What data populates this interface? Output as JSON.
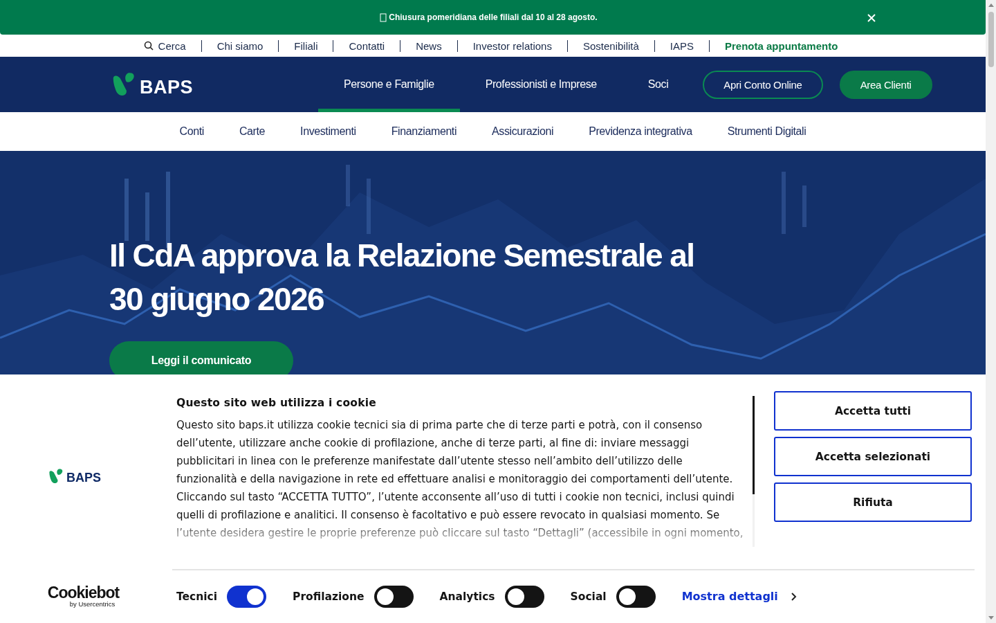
{
  "announcement": {
    "text": "Chiusura pomeridiana delle filiali dal 10 al 28 agosto."
  },
  "top_links": [
    {
      "label": "Cerca",
      "kind": "search"
    },
    {
      "label": "Chi siamo",
      "kind": "link"
    },
    {
      "label": "Filiali",
      "kind": "link"
    },
    {
      "label": "Contatti",
      "kind": "link"
    },
    {
      "label": "News",
      "kind": "link"
    },
    {
      "label": "Investor relations",
      "kind": "link"
    },
    {
      "label": "Sostenibilità",
      "kind": "link"
    },
    {
      "label": "IAPS",
      "kind": "link"
    },
    {
      "label": "Prenota appuntamento",
      "kind": "highlight"
    }
  ],
  "header": {
    "logo": "BAPS",
    "nav": [
      {
        "label": "Persone e Famiglie",
        "selected": true
      },
      {
        "label": "Professionisti e Imprese",
        "selected": false
      },
      {
        "label": "Soci",
        "selected": false
      }
    ],
    "buttons": [
      {
        "label": "Apri Conto Online",
        "kind": "outline"
      },
      {
        "label": "Area Clienti",
        "kind": "filled"
      }
    ]
  },
  "subnav": [
    "Conti",
    "Carte",
    "Investimenti",
    "Finanziamenti",
    "Assicurazioni",
    "Previdenza integrativa",
    "Strumenti Digitali"
  ],
  "hero": {
    "title": "Il CdA approva la Relazione Semestrale al 30 giugno 2026",
    "button": "Leggi il comunicato"
  },
  "cookie_banner": {
    "logo": "BAPS",
    "brand": "Cookiebot",
    "brand_sub": "by Usercentrics",
    "title": "Questo sito web utilizza i cookie",
    "body": "Questo sito baps.it utilizza cookie tecnici sia di prima parte che di terze parti e potrà, con il consenso dell’utente, utilizzare anche cookie di profilazione, anche di terze parti, al fine di: inviare messaggi pubblicitari in linea con le preferenze manifestate dall’utente stesso nell’ambito dell’utilizzo delle funzionalità e della navigazione in rete ed effettuare analisi e monitoraggio dei comportamenti dell’utente. Cliccando sul tasto “ACCETTA TUTTO”, l’utente acconsente all’uso di tutti i cookie non tecnici, inclusi quindi quelli di profilazione e analitici. Il consenso è facoltativo e può essere revocato in qualsiasi momento. Se l’utente desidera gestire le proprie preferenze può cliccare sul tasto “Dettagli” (accessibile in ogni momento,",
    "buttons": [
      "Accetta tutti",
      "Accetta selezionati",
      "Rifiuta"
    ],
    "toggles": [
      {
        "label": "Tecnici",
        "on": true
      },
      {
        "label": "Profilazione",
        "on": false
      },
      {
        "label": "Analytics",
        "on": false
      },
      {
        "label": "Social",
        "on": false
      }
    ],
    "details_link": "Mostra dettagli"
  }
}
